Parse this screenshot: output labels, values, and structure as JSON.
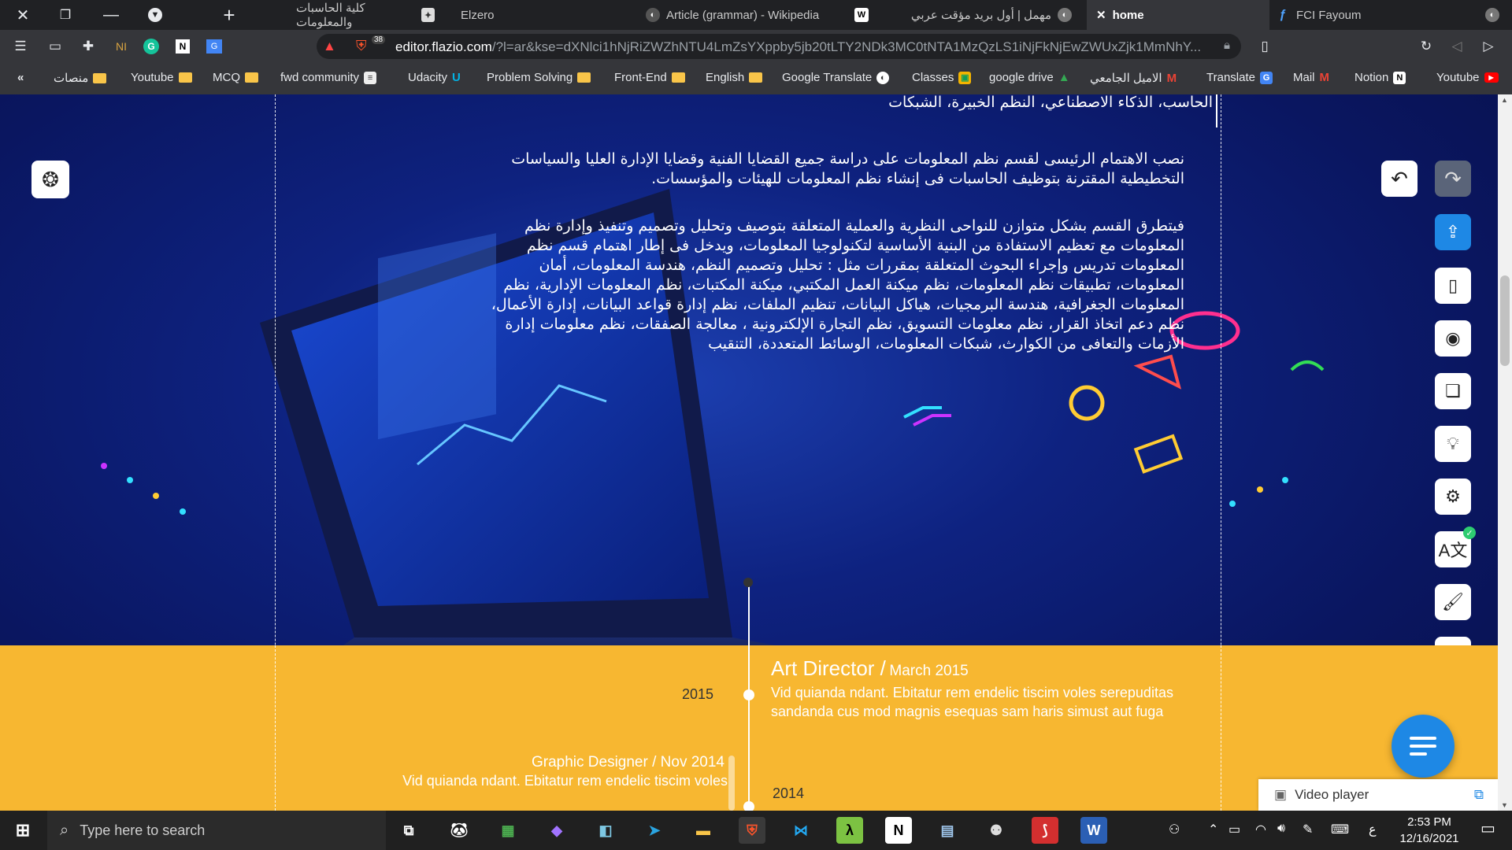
{
  "tabs": [
    {
      "title": "كلية الحاسبات والمعلومات"
    },
    {
      "title": "Elzero"
    },
    {
      "title": "Article (grammar) - Wikipedia"
    },
    {
      "title": "مهمل | أول بريد مؤقت عربي"
    },
    {
      "title": "home"
    },
    {
      "title": "FCI Fayoum"
    }
  ],
  "address": {
    "host": "editor.flazio.com",
    "path": "/?l=ar&kse=dXNlci1hNjRiZWZhNTU4LmZsYXppby5jb20tLTY2NDk3MC0tNTA1MzQzLS1iNjFkNjEwZWUxZjk1MmNhY...",
    "badge": "38"
  },
  "bookmarks": [
    {
      "label": "منصات"
    },
    {
      "label": "Youtube"
    },
    {
      "label": "MCQ"
    },
    {
      "label": "fwd community"
    },
    {
      "label": "Udacity"
    },
    {
      "label": "Problem Solving"
    },
    {
      "label": "Front-End"
    },
    {
      "label": "English"
    },
    {
      "label": "Google Translate"
    },
    {
      "label": "Classes"
    },
    {
      "label": "google drive"
    },
    {
      "label": "الاميل الجامعي"
    },
    {
      "label": "Translate"
    },
    {
      "label": "Mail"
    },
    {
      "label": "Notion"
    },
    {
      "label": "Youtube"
    }
  ],
  "content": {
    "top_partial": "الحاسب، الذكاء الاصطناعي، النظم الخبيرة، الشبكات",
    "para1": "نصب الاهتمام الرئيسى لقسم نظم المعلومات على دراسة جميع القضايا الفنية وقضايا الإدارة العليا والسياسات التخطيطية المقترنة بتوظيف الحاسبات فى إنشاء نظم المعلومات للهيئات والمؤسسات.",
    "para2": "فيتطرق القسم بشكل متوازن للنواحى النظرية والعملية المتعلقة بتوصيف وتحليل وتصميم وتنفيذ وإدارة نظم المعلومات مع تعظيم الاستفادة من البنية الأساسية لتكنولوجيا المعلومات، ويدخل فى إطار اهتمام قسم نظم المعلومات تدريس وإجراء البحوث المتعلقة بمقررات مثل : تحليل وتصميم النظم، هندسة المعلومات، أمان المعلومات، تطبيقات نظم المعلومات، نظم ميكنة العمل المكتبي، ميكنة المكتبات، نظم المعلومات الإدارية، نظم المعلومات الجغرافية، هندسة البرمجيات، هياكل البيانات، تنظيم الملفات، نظم إدارة قواعد البيانات، إدارة الأعمال، نظم دعم اتخاذ القرار، نظم معلومات التسويق، نظم التجارة الإلكترونية ، معالجة الصفقات، نظم معلومات إدارة الأزمات والتعافى من الكوارث، شبكات المعلومات، الوسائط المتعددة، التنقيب"
  },
  "timeline": {
    "item1": {
      "year": "2015",
      "title": "Art Director /",
      "date": "March 2015",
      "text": "Vid quianda ndant. Ebitatur rem endelic tiscim voles serepuditas sandanda cus mod magnis esequas sam haris simust aut fuga"
    },
    "item2": {
      "year": "2014",
      "title": "Graphic Designer / Nov 2014",
      "text": "Vid quianda ndant. Ebitatur rem endelic tiscim voles"
    }
  },
  "video_player": {
    "label": "Video player"
  },
  "taskbar": {
    "search_placeholder": "Type here to search",
    "time": "2:53 PM",
    "date": "12/16/2021",
    "lang": "ع"
  },
  "colors": {
    "timeline_bg": "#f7b731",
    "fab": "#1e88e5",
    "page_bg": "#0e2280"
  }
}
